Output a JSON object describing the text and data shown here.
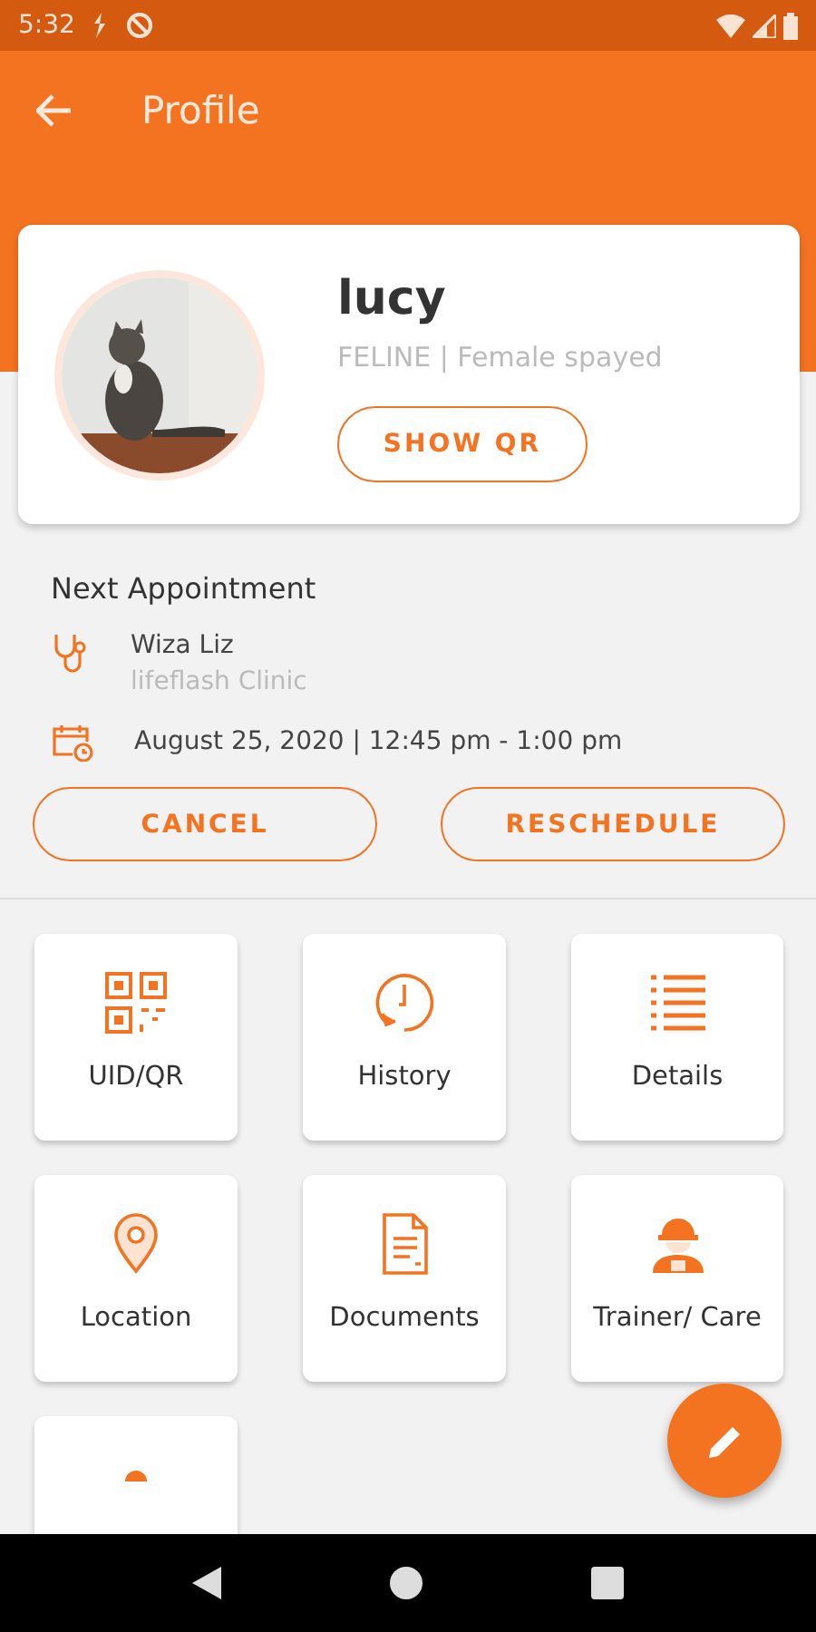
{
  "status_bar": {
    "time": "5:32"
  },
  "app_bar": {
    "title": "Profile"
  },
  "pet": {
    "name": "lucy",
    "subtitle": "FELINE | Female spayed",
    "button": "SHOW QR"
  },
  "appointment": {
    "heading": "Next Appointment",
    "doctor": "Wiza Liz",
    "clinic": "lifeflash Clinic",
    "datetime": "August 25, 2020 | 12:45 pm - 1:00 pm",
    "buttons": [
      "CANCEL",
      "RESCHEDULE"
    ]
  },
  "tiles": [
    {
      "kind": "qr",
      "label": "UID/QR"
    },
    {
      "kind": "history",
      "label": "History"
    },
    {
      "kind": "details",
      "label": "Details"
    },
    {
      "kind": "location",
      "label": "Location"
    },
    {
      "kind": "documents",
      "label": "Documents"
    },
    {
      "kind": "trainer",
      "label": "Trainer/ Care"
    },
    {
      "kind": "partial"
    }
  ]
}
